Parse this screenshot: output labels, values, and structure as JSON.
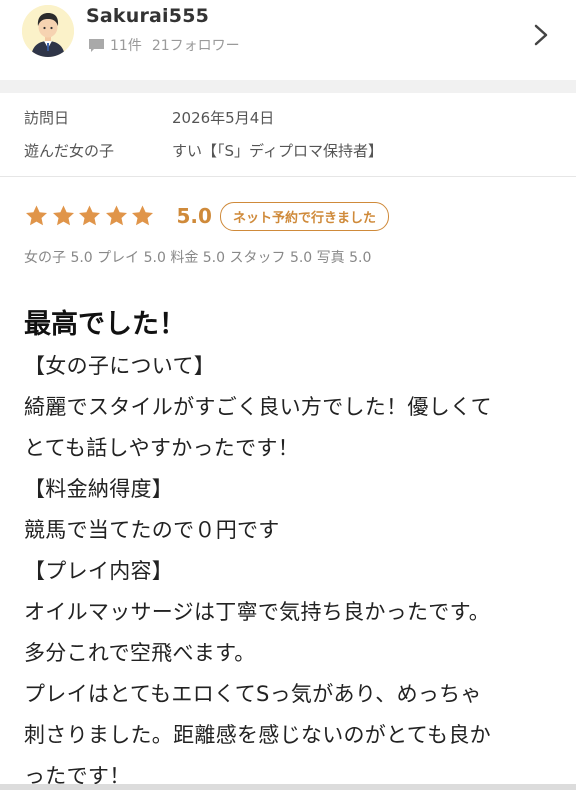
{
  "profile": {
    "username": "Sakurai555",
    "review_count": "11件",
    "followers": "21フォロワー"
  },
  "visit": {
    "date_label": "訪問日",
    "date_value": "2026年5月4日",
    "girl_label": "遊んだ女の子",
    "girl_value": "すい【「S」ディプロマ保持者】"
  },
  "rating": {
    "stars": 5,
    "score": "5.0",
    "badge": "ネット予約で行きました",
    "subscores": "女の子 5.0 プレイ 5.0 料金 5.0 スタッフ 5.0 写真 5.0"
  },
  "review": {
    "title": "最高でした！",
    "lines": [
      "【女の子について】",
      "綺麗でスタイルがすごく良い方でした！優しくて",
      "とても話しやすかったです！",
      "【料金納得度】",
      "競馬で当てたので０円です",
      "【プレイ内容】",
      "オイルマッサージは丁寧で気持ち良かったです。",
      "多分これで空飛べます。",
      "プレイはとてもエロくてSっ気があり、めっちゃ",
      "刺さりました。距離感を感じないのがとても良か",
      "ったです！"
    ]
  },
  "colors": {
    "accent": "#cf8a3a",
    "star": "#e0954a",
    "muted_text": "#9a9a9a"
  },
  "icons": {
    "avatar": "user-avatar-icon",
    "review_count": "chat-bubble-icon",
    "navigate": "chevron-right-icon",
    "rating": "star-icon"
  }
}
